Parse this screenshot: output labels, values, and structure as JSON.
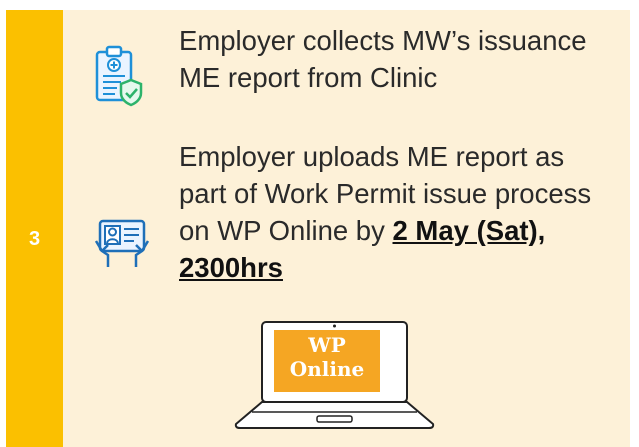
{
  "step": {
    "number": "3"
  },
  "item1": {
    "text": "Employer collects MW’s issuance ME report from Clinic",
    "icon": "medical-report-shield-icon"
  },
  "item2": {
    "text_before": "Employer uploads ME report as part of Work Permit issue process on WP Online by ",
    "deadline": "2 May (Sat), 2300hrs",
    "icon": "id-card-hands-icon"
  },
  "laptop": {
    "screen_line1": "WP",
    "screen_line2": "Online"
  },
  "colors": {
    "accent": "#fbc000",
    "background": "#fdf1d8",
    "screen": "#f5a623"
  }
}
